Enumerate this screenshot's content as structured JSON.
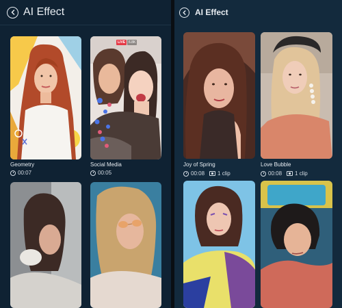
{
  "left_screen": {
    "title": "AI Effect",
    "cards": [
      {
        "name": "Geometry",
        "duration": "00:07"
      },
      {
        "name": "Social Media",
        "duration": "00:05",
        "badge": "LIVE",
        "badge_count": "6.8K"
      },
      {
        "name": "",
        "duration": ""
      },
      {
        "name": "",
        "duration": ""
      }
    ]
  },
  "right_screen": {
    "title": "AI Effect",
    "cards": [
      {
        "name": "Joy of Spring",
        "duration": "00:08",
        "clips": "1 clip"
      },
      {
        "name": "Love Bubble",
        "duration": "00:08",
        "clips": "1 clip"
      },
      {
        "name": "",
        "duration": "",
        "clips": ""
      },
      {
        "name": "",
        "duration": "",
        "clips": ""
      }
    ]
  },
  "icons": {
    "back": "back-arrow-icon",
    "duration": "clock-icon",
    "clips": "film-icon"
  },
  "colors": {
    "left_bg": "#0f2233",
    "right_bg": "#132a3d",
    "badge_live": "#e53946"
  }
}
